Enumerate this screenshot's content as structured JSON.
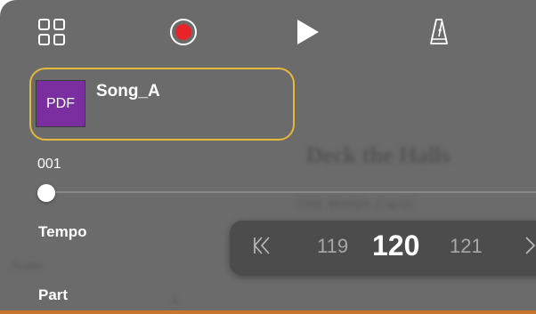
{
  "toolbar": {
    "grid_icon": "grid-menu-icon",
    "record_icon": "record-icon",
    "play_icon": "play-icon",
    "metronome_icon": "metronome-icon"
  },
  "song": {
    "thumbnail_label": "PDF",
    "title": "Song_A"
  },
  "score": {
    "title": "Deck the Halls",
    "subtitle": "Old Welsh Carol"
  },
  "position": {
    "bar_number": "001",
    "fraction": 0.0
  },
  "tempo": {
    "label": "Tempo",
    "previous": "119",
    "current": "120",
    "next": "121"
  },
  "part": {
    "label": "Part"
  },
  "background_text": {
    "left": "Audio",
    "mid": "A"
  },
  "colors": {
    "background": "#6b6b6b",
    "highlight_border": "#e5b73b",
    "pdf_thumbnail": "#7a2ea0",
    "record": "#e8232a",
    "popup": "#4c4c4c"
  }
}
